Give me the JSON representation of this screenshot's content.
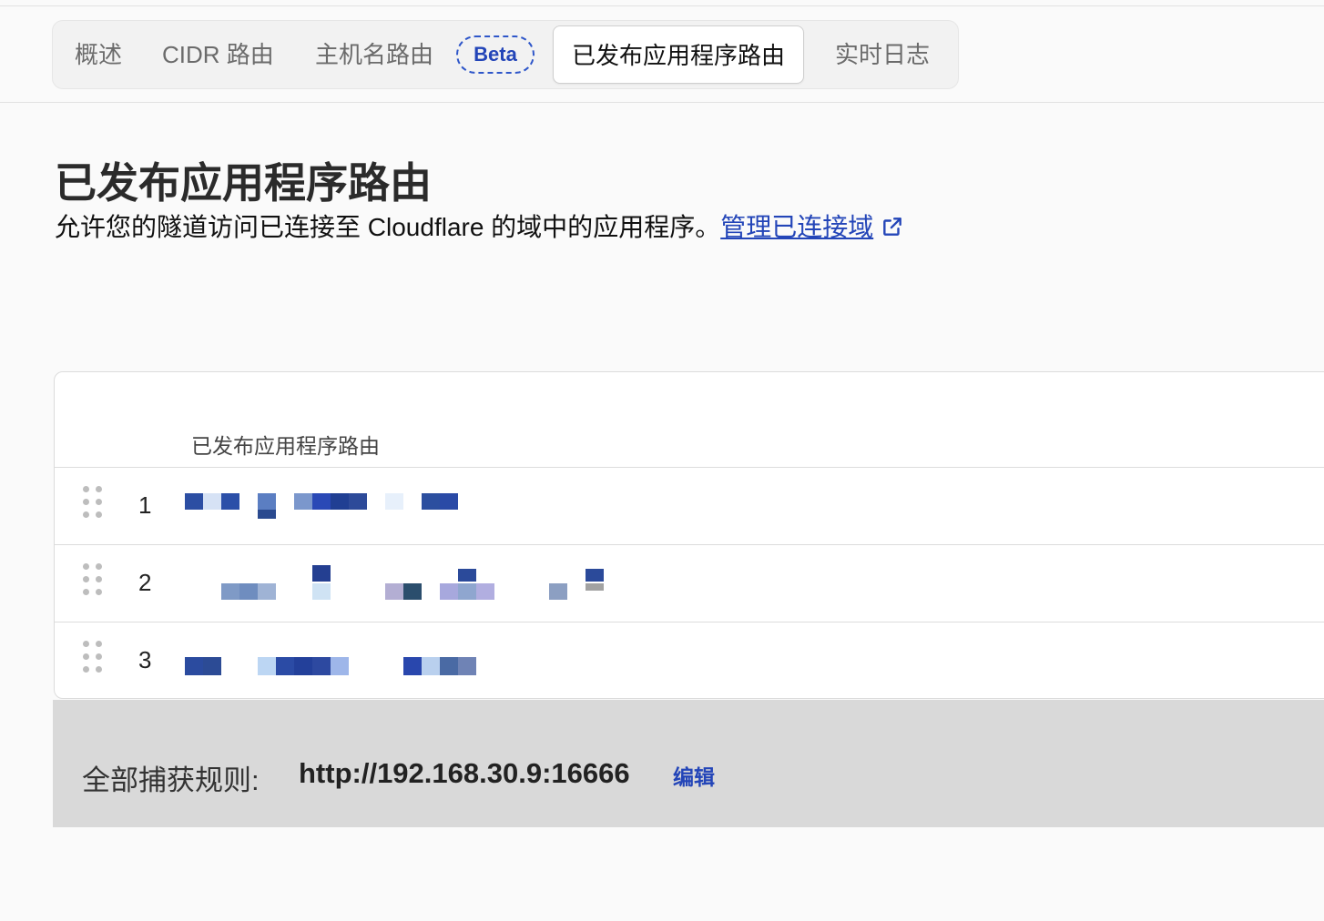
{
  "tabs": [
    {
      "label": "概述"
    },
    {
      "label": "CIDR 路由"
    },
    {
      "label": "主机名路由"
    },
    {
      "label": "已发布应用程序路由"
    },
    {
      "label": "实时日志"
    }
  ],
  "beta_badge": "Beta",
  "page": {
    "title": "已发布应用程序路由",
    "description": "允许您的隧道访问已连接至 Cloudflare 的域中的应用程序。",
    "manage_link": "管理已连接域"
  },
  "table": {
    "header": "已发布应用程序路由",
    "rows": [
      {
        "index": "1"
      },
      {
        "index": "2"
      },
      {
        "index": "3"
      }
    ]
  },
  "catch_all": {
    "label": "全部捕获规则:",
    "value": "http://192.168.30.9:16666",
    "edit": "编辑"
  },
  "colors": {
    "accent": "#2345b8",
    "active_tab_bg": "#ffffff",
    "catch_all_bg": "#d9d9d9"
  }
}
